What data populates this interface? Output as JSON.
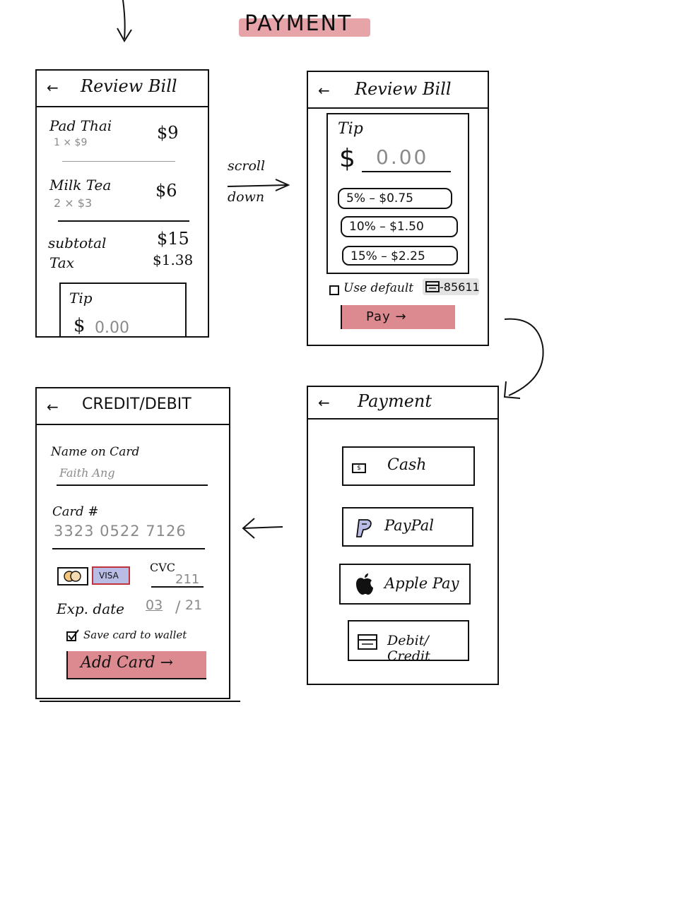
{
  "page_title": "PAYMENT",
  "connectors": {
    "scroll_line1": "scroll",
    "scroll_line2": "down"
  },
  "screen1": {
    "back": "←",
    "title": "Review Bill",
    "items": [
      {
        "name": "Pad Thai",
        "qty": "1 × $9",
        "price": "$9"
      },
      {
        "name": "Milk Tea",
        "qty": "2 × $3",
        "price": "$6"
      }
    ],
    "subtotal_label": "subtotal",
    "subtotal_value": "$15",
    "tax_label": "Tax",
    "tax_value": "$1.38",
    "tip_label": "Tip",
    "tip_dollar": "$",
    "tip_placeholder": "0.00"
  },
  "screen2": {
    "back": "←",
    "title": "Review Bill",
    "tip_label": "Tip",
    "dollar": "$",
    "tip_placeholder": "0.00",
    "tip_options": [
      "5% – $0.75",
      "10% – $1.50",
      "15% – $2.25"
    ],
    "default_card_label": "Use default",
    "default_card_number": "-85611",
    "pay_label": "Pay →"
  },
  "screen3": {
    "back": "←",
    "title": "Payment",
    "options": [
      {
        "label": "Cash",
        "icon": "cash-icon"
      },
      {
        "label": "PayPal",
        "icon": "paypal-icon"
      },
      {
        "label": "Apple Pay",
        "icon": "apple-icon"
      },
      {
        "label": "Debit/ Credit",
        "icon": "card-icon"
      }
    ],
    "cash_glyph": "$"
  },
  "screen4": {
    "back": "←",
    "title": "CREDIT/DEBIT",
    "name_label": "Name on Card",
    "name_value": "Faith Ang",
    "card_label": "Card #",
    "card_value": "3323 0522 7126",
    "visa": "VISA",
    "cvc_label": "CVC",
    "cvc_value": "211",
    "exp_label": "Exp. date",
    "exp_month": "03",
    "exp_sep": "/",
    "exp_year": "21",
    "save_label": "Save card to wallet",
    "add_label": "Add Card →"
  },
  "colors": {
    "accent_red": "#dc8a8f",
    "visa_highlight": "#b9bde6",
    "ink": "#111111",
    "grey": "#8a8a8a"
  }
}
